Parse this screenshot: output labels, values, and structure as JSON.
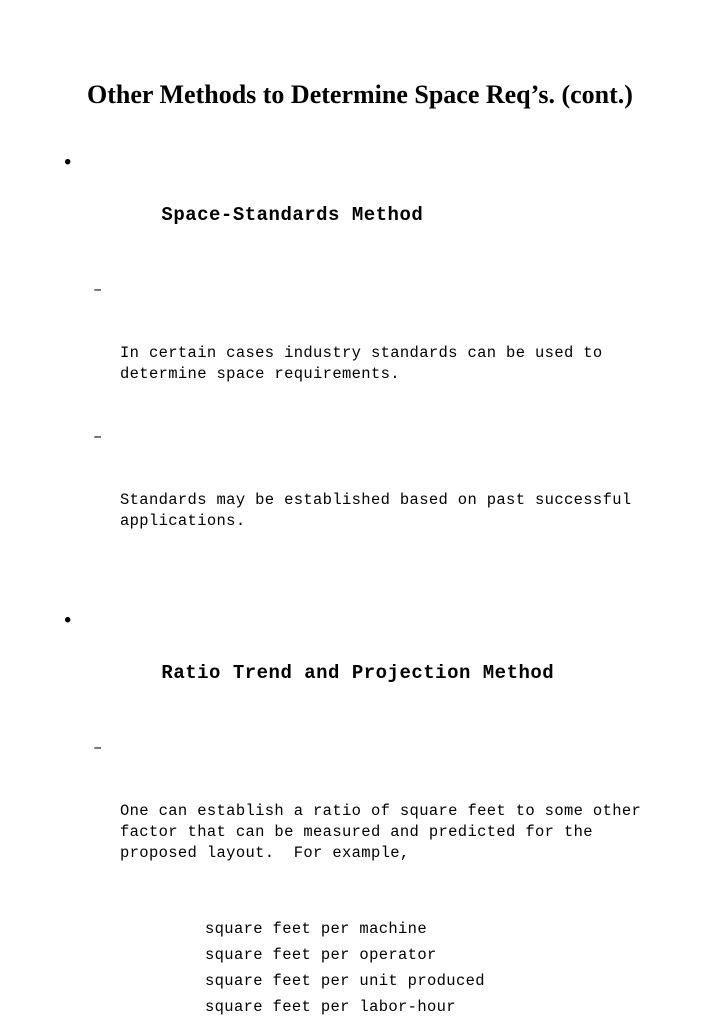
{
  "slide": {
    "title": "Other Methods to Determine Space Req’s. (cont.)",
    "background_color": "#ffffff",
    "text_color": "#000000",
    "bullet_marker": "•",
    "dash_marker": "–",
    "sections": [
      {
        "heading": "Space-Standards Method",
        "points": [
          "In certain cases industry standards can be used to\ndetermine space requirements.",
          "Standards may be established based on past successful\napplications."
        ]
      },
      {
        "heading": "Ratio Trend and Projection Method",
        "points": [
          "One can establish a ratio of square feet to some other\nfactor that can be measured and predicted for the\nproposed layout.  For example,"
        ],
        "examples": [
          "square feet per machine",
          "square feet per operator",
          "square feet per unit produced",
          "square feet per labor-hour"
        ]
      }
    ]
  }
}
